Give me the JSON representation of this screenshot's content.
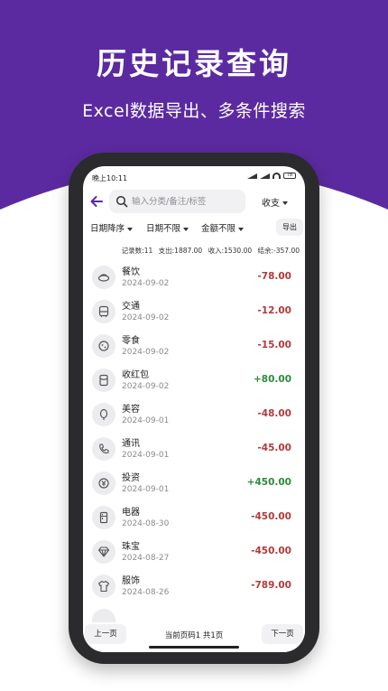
{
  "hero": {
    "title": "历史记录查询",
    "subtitle": "Excel数据导出、多条件搜索",
    "color": "#5b2aa0"
  },
  "status_bar": {
    "time": "晚上10:11",
    "battery": "78"
  },
  "search": {
    "placeholder": "输入分类/备注/标签",
    "value": "",
    "type_label": "收支"
  },
  "filters": {
    "sort": "日期降序",
    "date": "日期不限",
    "amount": "金额不限",
    "export": "导出"
  },
  "summary": {
    "count": "记录数:11",
    "expense": "支出:1887.00",
    "income": "收入:1530.00",
    "balance": "结余:-357.00"
  },
  "records": [
    {
      "category": "餐饮",
      "date": "2024-09-02",
      "amount": "-78.00",
      "icon": "food-icon"
    },
    {
      "category": "交通",
      "date": "2024-09-02",
      "amount": "-12.00",
      "icon": "bus-icon"
    },
    {
      "category": "零食",
      "date": "2024-09-02",
      "amount": "-15.00",
      "icon": "snack-icon"
    },
    {
      "category": "收红包",
      "date": "2024-09-02",
      "amount": "+80.00",
      "icon": "red-packet-icon"
    },
    {
      "category": "美容",
      "date": "2024-09-01",
      "amount": "-48.00",
      "icon": "beauty-icon"
    },
    {
      "category": "通讯",
      "date": "2024-09-01",
      "amount": "-45.00",
      "icon": "phone-icon"
    },
    {
      "category": "投资",
      "date": "2024-09-01",
      "amount": "+450.00",
      "icon": "investment-icon"
    },
    {
      "category": "电器",
      "date": "2024-08-30",
      "amount": "-450.00",
      "icon": "appliance-icon"
    },
    {
      "category": "珠宝",
      "date": "2024-08-27",
      "amount": "-450.00",
      "icon": "jewelry-icon"
    },
    {
      "category": "服饰",
      "date": "2024-08-26",
      "amount": "-789.00",
      "icon": "clothing-icon"
    }
  ],
  "pagination": {
    "prev": "上一页",
    "info": "当前页码1 共1页",
    "next": "下一页"
  },
  "colors": {
    "negative": "#b23a3a",
    "positive": "#2e8b3b",
    "accent": "#5b2aa0"
  }
}
